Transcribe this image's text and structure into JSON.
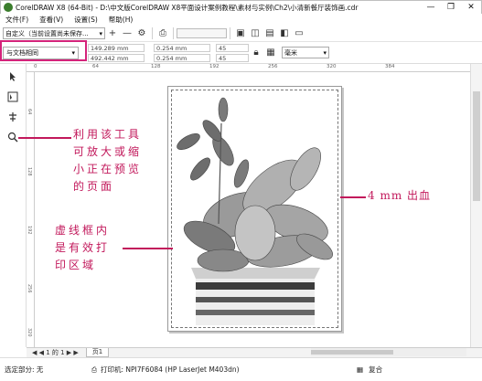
{
  "window": {
    "title": "CorelDRAW X8 (64-Bit) - D:\\中文版CorelDRAW X8平面设计案例教程\\素材与实例\\Ch2\\小清新餐厅装饰画.cdr",
    "minimize": "—",
    "restore": "❐",
    "close": "✕"
  },
  "menu": [
    "文件(F)",
    "查看(V)",
    "设置(S)",
    "帮助(H)"
  ],
  "toolbar1": {
    "preset": "自定义（当前设置尚未保存...",
    "add": "+",
    "remove": "—",
    "gear": "⚙",
    "print": "⎙"
  },
  "toolbar2": {
    "page_size": "与文档相同",
    "width": "149.289 mm",
    "height": "492.442 mm",
    "offset_x": "0.254 mm",
    "offset_y": "0.254 mm",
    "val_a": "45",
    "val_b": "45",
    "units": "毫米"
  },
  "ruler": {
    "top_ticks": [
      "0",
      "64",
      "128",
      "192",
      "256",
      "320",
      "384"
    ],
    "left_ticks": [
      "64",
      "128",
      "192",
      "256",
      "320"
    ]
  },
  "annotations": {
    "zoom_tool": [
      "利用该工具",
      "可放大或缩",
      "小正在预览",
      "的页面"
    ],
    "bleed": "4 mm 出血",
    "print_area": [
      "虚线框内",
      "是有效打",
      "印区域"
    ]
  },
  "pager": {
    "nav": "◀ ◀ 1 的 1 ▶ ▶",
    "page_tab": "页1"
  },
  "status": {
    "selection": "选定部分: 无",
    "printer": "打印机: NPI7F6084 (HP LaserJet M403dn)",
    "mode": "复合"
  },
  "colors": {
    "annotation": "#c2185b"
  }
}
